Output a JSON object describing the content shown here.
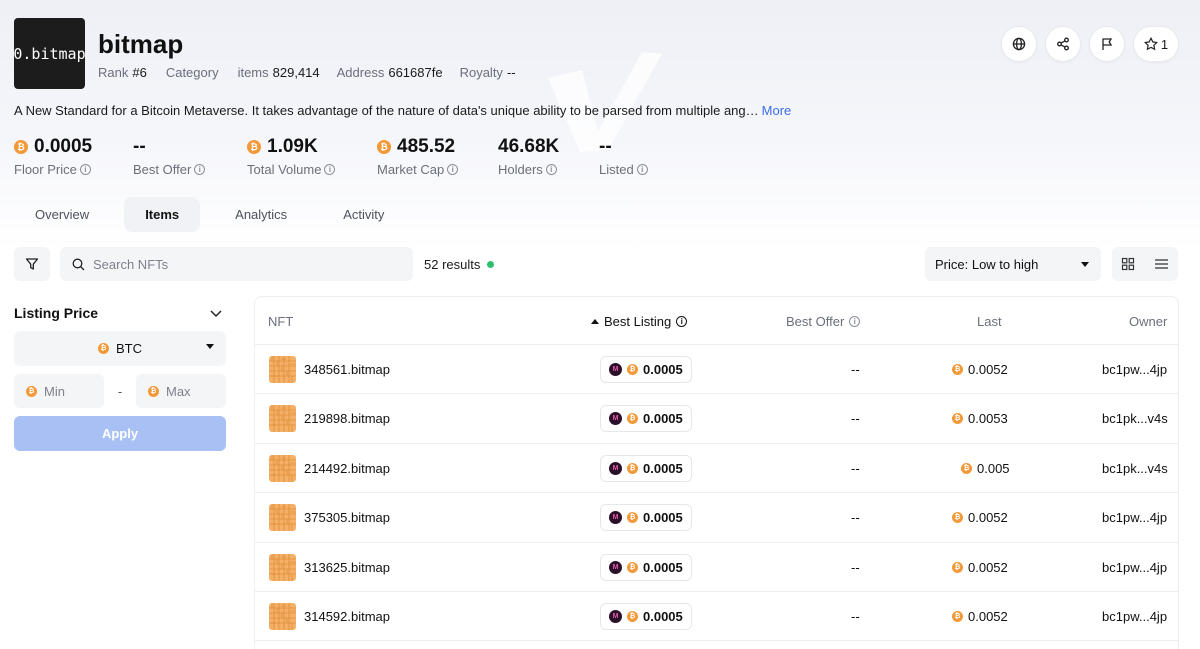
{
  "collection": {
    "logo_text": "0.bitmap",
    "name": "bitmap",
    "rank_label": "Rank",
    "rank_value": "#6",
    "category_label": "Category",
    "items_label": "items",
    "items_value": "829,414",
    "address_label": "Address",
    "address_value": "661687fe",
    "royalty_label": "Royalty",
    "royalty_value": "--",
    "description": "A New Standard for a Bitcoin Metaverse. It takes advantage of the nature of data's unique ability to be parsed from multiple ang…",
    "more_label": "More"
  },
  "actions": {
    "icons": [
      "globe-icon",
      "share-icon",
      "flag-icon",
      "star-icon"
    ],
    "star_count": "1"
  },
  "stats": [
    {
      "value": "0.0005",
      "label": "Floor Price",
      "btc": true
    },
    {
      "value": "--",
      "label": "Best Offer",
      "btc": false
    },
    {
      "value": "1.09K",
      "label": "Total Volume",
      "btc": true
    },
    {
      "value": "485.52",
      "label": "Market Cap",
      "btc": true
    },
    {
      "value": "46.68K",
      "label": "Holders",
      "btc": false
    },
    {
      "value": "--",
      "label": "Listed",
      "btc": false
    }
  ],
  "tabs": [
    {
      "label": "Overview",
      "active": false
    },
    {
      "label": "Items",
      "active": true
    },
    {
      "label": "Analytics",
      "active": false
    },
    {
      "label": "Activity",
      "active": false
    }
  ],
  "toolbar": {
    "search_placeholder": "Search NFTs",
    "results_text": "52 results",
    "sort_value": "Price: Low to high"
  },
  "sidebar": {
    "title": "Listing Price",
    "currency": "BTC",
    "min_placeholder": "Min",
    "max_placeholder": "Max",
    "dash": "-",
    "apply_label": "Apply"
  },
  "table": {
    "headers": {
      "nft": "NFT",
      "best_listing": "Best Listing",
      "best_offer": "Best Offer",
      "last": "Last",
      "owner": "Owner"
    },
    "rows": [
      {
        "name": "348561.bitmap",
        "listing": "0.0005",
        "offer": "--",
        "last": "0.0052",
        "owner": "bc1pw...4jp"
      },
      {
        "name": "219898.bitmap",
        "listing": "0.0005",
        "offer": "--",
        "last": "0.0053",
        "owner": "bc1pk...v4s"
      },
      {
        "name": "214492.bitmap",
        "listing": "0.0005",
        "offer": "--",
        "last": "0.005",
        "owner": "bc1pk...v4s"
      },
      {
        "name": "375305.bitmap",
        "listing": "0.0005",
        "offer": "--",
        "last": "0.0052",
        "owner": "bc1pw...4jp"
      },
      {
        "name": "313625.bitmap",
        "listing": "0.0005",
        "offer": "--",
        "last": "0.0052",
        "owner": "bc1pw...4jp"
      },
      {
        "name": "314592.bitmap",
        "listing": "0.0005",
        "offer": "--",
        "last": "0.0052",
        "owner": "bc1pw...4jp"
      }
    ]
  },
  "colors": {
    "btc_orange": "#f29a3a",
    "link_blue": "#3a6ee8",
    "status_green": "#2fbf71",
    "apply_disabled": "#a9c0f5",
    "thumb_orange": "#f0a24a"
  }
}
